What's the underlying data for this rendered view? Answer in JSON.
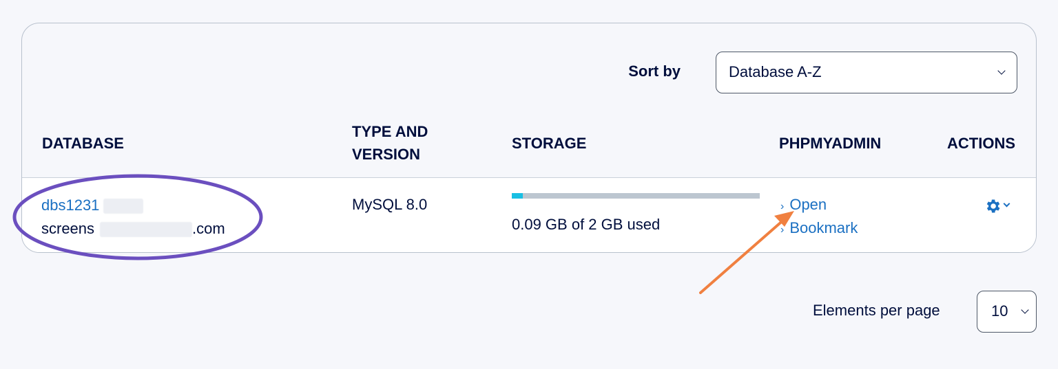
{
  "controls": {
    "sort_label": "Sort by",
    "sort_value": "Database A-Z",
    "per_page_label": "Elements per page",
    "per_page_value": "10"
  },
  "table": {
    "headers": {
      "database": "DATABASE",
      "type_line1": "TYPE AND",
      "type_line2": "VERSION",
      "storage": "STORAGE",
      "phpmyadmin": "PHPMYADMIN",
      "actions": "ACTIONS"
    },
    "rows": [
      {
        "db_name": "dbs1231",
        "db_host_prefix": "screens",
        "db_host_suffix": ".com",
        "type_version": "MySQL 8.0",
        "storage_text": "0.09 GB of 2 GB used",
        "storage_used_fraction": 0.045,
        "open_label": "Open",
        "bookmark_label": "Bookmark"
      }
    ]
  },
  "icons": {
    "sort_chevron": "chevron-down-icon",
    "actions": "gear-icon",
    "link_arrow": "chevron-right-icon"
  },
  "colors": {
    "text": "#000e3c",
    "link": "#1b70c2",
    "storage_fill": "#19bfe3",
    "storage_track": "#bcc6d0",
    "annotation_circle": "#6b4fbf",
    "annotation_arrow": "#f08040"
  }
}
